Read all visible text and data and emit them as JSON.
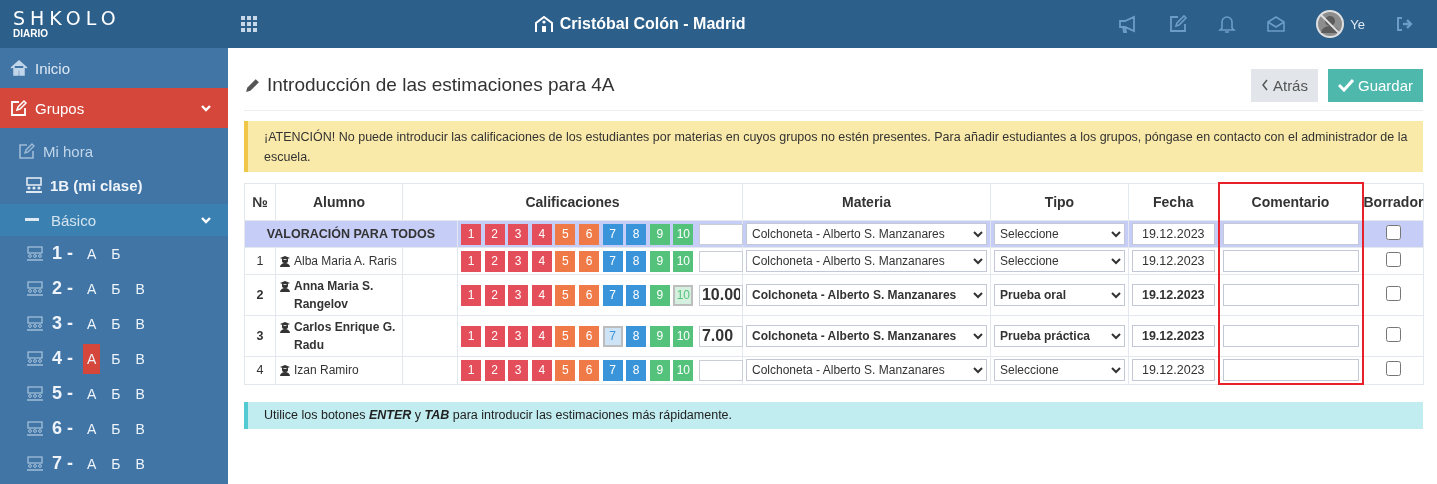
{
  "header": {
    "logo": "SHKOLO",
    "logo_subtitle": "DIARIO",
    "school": "Cristóbal Colón - Madrid",
    "user": "Ye"
  },
  "sidebar": {
    "items": [
      {
        "kind": "home",
        "label": "Inicio",
        "selected": false
      },
      {
        "kind": "group",
        "label": "Grupos",
        "selected": true,
        "expanded": true
      },
      {
        "kind": "sub",
        "label": "Mi hora",
        "selected": false
      },
      {
        "kind": "class",
        "label": "1B (mi clase)",
        "selected": false
      },
      {
        "kind": "level",
        "label": "Básico",
        "selected": false,
        "expanded": true
      }
    ],
    "grades": [
      {
        "number": "1 -",
        "letters": [
          {
            "label": "А",
            "selected": false
          },
          {
            "label": "Б",
            "selected": false
          }
        ]
      },
      {
        "number": "2 -",
        "letters": [
          {
            "label": "А",
            "selected": false
          },
          {
            "label": "Б",
            "selected": false
          },
          {
            "label": "В",
            "selected": false
          }
        ]
      },
      {
        "number": "3 -",
        "letters": [
          {
            "label": "А",
            "selected": false
          },
          {
            "label": "Б",
            "selected": false
          },
          {
            "label": "В",
            "selected": false
          }
        ]
      },
      {
        "number": "4 -",
        "letters": [
          {
            "label": "А",
            "selected": true
          },
          {
            "label": "Б",
            "selected": false
          },
          {
            "label": "В",
            "selected": false
          }
        ]
      },
      {
        "number": "5 -",
        "letters": [
          {
            "label": "А",
            "selected": false
          },
          {
            "label": "Б",
            "selected": false
          },
          {
            "label": "В",
            "selected": false
          }
        ]
      },
      {
        "number": "6 -",
        "letters": [
          {
            "label": "А",
            "selected": false
          },
          {
            "label": "Б",
            "selected": false
          },
          {
            "label": "В",
            "selected": false
          }
        ]
      },
      {
        "number": "7 -",
        "letters": [
          {
            "label": "А",
            "selected": false
          },
          {
            "label": "Б",
            "selected": false
          },
          {
            "label": "В",
            "selected": false
          }
        ]
      }
    ]
  },
  "page": {
    "title": "Introducción de las estimaciones para 4A",
    "back_button": "Atrás",
    "save_button": "Guardar",
    "alert": "¡ATENCIÓN! No puede introducir las calificaciones de los estudiantes por materias en cuyos grupos no estén presentes. Para añadir estudiantes a los grupos, póngase en contacto con el administrador de la escuela.",
    "info": "Utilice los botones **ENTER** y **TAB** para introducir las estimaciones más rápidamente."
  },
  "table": {
    "columns": [
      {
        "label": "№",
        "highlighted": false
      },
      {
        "label": "Alumno",
        "highlighted": false
      },
      {
        "label": "Calificaciones",
        "highlighted": false
      },
      {
        "label": "Materia",
        "highlighted": false
      },
      {
        "label": "Tipo",
        "highlighted": false
      },
      {
        "label": "Fecha",
        "highlighted": false
      },
      {
        "label": "Comentario",
        "highlighted": true
      },
      {
        "label": "Borrador",
        "highlighted": false
      }
    ],
    "all_row": {
      "label": "VALORACIÓN PARA TODOS",
      "subject": "Colchoneta - Alberto S. Manzanares",
      "type": "Seleccione",
      "date": "19.12.2023",
      "draft": false,
      "grades": [
        {
          "label": "1",
          "color": "#e44d5a",
          "selected": false
        },
        {
          "label": "2",
          "color": "#e44d5a",
          "selected": false
        },
        {
          "label": "3",
          "color": "#e44d5a",
          "selected": false
        },
        {
          "label": "4",
          "color": "#e44d5a",
          "selected": false
        },
        {
          "label": "5",
          "color": "#ef7a48",
          "selected": false
        },
        {
          "label": "6",
          "color": "#ef7a48",
          "selected": false
        },
        {
          "label": "7",
          "color": "#3994d9",
          "selected": false
        },
        {
          "label": "8",
          "color": "#3994d9",
          "selected": false
        },
        {
          "label": "9",
          "color": "#55c27c",
          "selected": false
        },
        {
          "label": "10",
          "color": "#55c27c",
          "selected": false
        }
      ]
    },
    "rows": [
      {
        "number": "1",
        "student": "Alba Maria A. Raris",
        "subject": "Colchoneta - Alberto S. Manzanares",
        "type": "Seleccione",
        "date": "19.12.2023",
        "draft": false,
        "grades": [
          {
            "label": "1",
            "color": "#e44d5a",
            "selected": false
          },
          {
            "label": "2",
            "color": "#e44d5a",
            "selected": false
          },
          {
            "label": "3",
            "color": "#e44d5a",
            "selected": false
          },
          {
            "label": "4",
            "color": "#e44d5a",
            "selected": false
          },
          {
            "label": "5",
            "color": "#ef7a48",
            "selected": false
          },
          {
            "label": "6",
            "color": "#ef7a48",
            "selected": false
          },
          {
            "label": "7",
            "color": "#3994d9",
            "selected": false
          },
          {
            "label": "8",
            "color": "#3994d9",
            "selected": false
          },
          {
            "label": "9",
            "color": "#55c27c",
            "selected": false
          },
          {
            "label": "10",
            "color": "#55c27c",
            "selected": false
          }
        ]
      },
      {
        "number": "2",
        "student": "Anna Maria S. Rangelov",
        "value": "10.00",
        "subject": "Colchoneta - Alberto S. Manzanares",
        "type": "Prueba oral",
        "date": "19.12.2023",
        "draft": false,
        "grades": [
          {
            "label": "1",
            "color": "#e44d5a",
            "selected": false
          },
          {
            "label": "2",
            "color": "#e44d5a",
            "selected": false
          },
          {
            "label": "3",
            "color": "#e44d5a",
            "selected": false
          },
          {
            "label": "4",
            "color": "#e44d5a",
            "selected": false
          },
          {
            "label": "5",
            "color": "#ef7a48",
            "selected": false
          },
          {
            "label": "6",
            "color": "#ef7a48",
            "selected": false
          },
          {
            "label": "7",
            "color": "#3994d9",
            "selected": false
          },
          {
            "label": "8",
            "color": "#3994d9",
            "selected": false
          },
          {
            "label": "9",
            "color": "#55c27c",
            "selected": false
          },
          {
            "label": "10",
            "color": "#55c27c",
            "selected": true
          }
        ]
      },
      {
        "number": "3",
        "student": "Carlos Enrique G. Radu",
        "value": "7.00",
        "subject": "Colchoneta - Alberto S. Manzanares",
        "type": "Prueba práctica",
        "date": "19.12.2023",
        "draft": false,
        "grades": [
          {
            "label": "1",
            "color": "#e44d5a",
            "selected": false
          },
          {
            "label": "2",
            "color": "#e44d5a",
            "selected": false
          },
          {
            "label": "3",
            "color": "#e44d5a",
            "selected": false
          },
          {
            "label": "4",
            "color": "#e44d5a",
            "selected": false
          },
          {
            "label": "5",
            "color": "#ef7a48",
            "selected": false
          },
          {
            "label": "6",
            "color": "#ef7a48",
            "selected": false
          },
          {
            "label": "7",
            "color": "#3994d9",
            "selected": true
          },
          {
            "label": "8",
            "color": "#3994d9",
            "selected": false
          },
          {
            "label": "9",
            "color": "#55c27c",
            "selected": false
          },
          {
            "label": "10",
            "color": "#55c27c",
            "selected": false
          }
        ]
      },
      {
        "number": "4",
        "student": "Izan Ramiro",
        "subject": "Colchoneta - Alberto S. Manzanares",
        "type": "Seleccione",
        "date": "19.12.2023",
        "draft": false,
        "grades": [
          {
            "label": "1",
            "color": "#e44d5a",
            "selected": false
          },
          {
            "label": "2",
            "color": "#e44d5a",
            "selected": false
          },
          {
            "label": "3",
            "color": "#e44d5a",
            "selected": false
          },
          {
            "label": "4",
            "color": "#e44d5a",
            "selected": false
          },
          {
            "label": "5",
            "color": "#ef7a48",
            "selected": false
          },
          {
            "label": "6",
            "color": "#ef7a48",
            "selected": false
          },
          {
            "label": "7",
            "color": "#3994d9",
            "selected": false
          },
          {
            "label": "8",
            "color": "#3994d9",
            "selected": false
          },
          {
            "label": "9",
            "color": "#55c27c",
            "selected": false
          },
          {
            "label": "10",
            "color": "#55c27c",
            "selected": false
          }
        ]
      }
    ]
  }
}
